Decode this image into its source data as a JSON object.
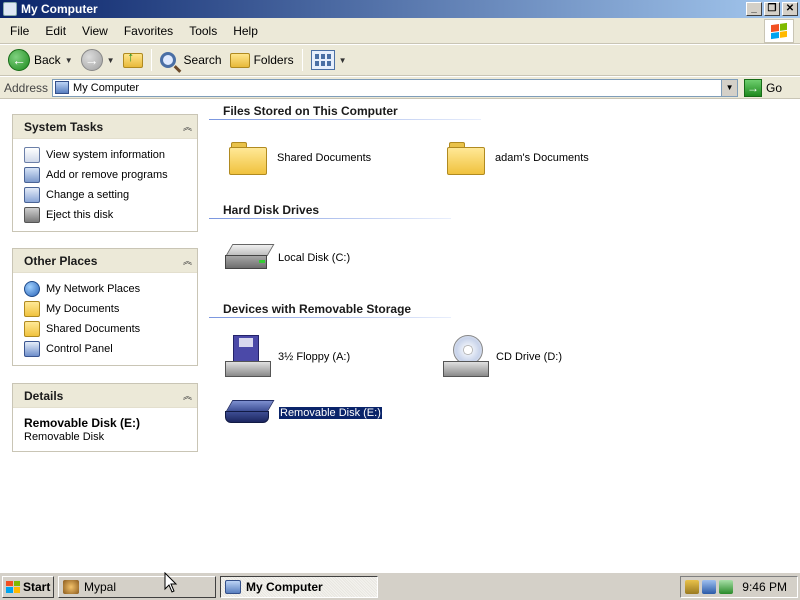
{
  "window": {
    "title": "My Computer"
  },
  "menu": [
    "File",
    "Edit",
    "View",
    "Favorites",
    "Tools",
    "Help"
  ],
  "toolbar": {
    "back": "Back",
    "search": "Search",
    "folders": "Folders"
  },
  "address": {
    "label": "Address",
    "value": "My Computer",
    "go": "Go"
  },
  "system_tasks": {
    "title": "System Tasks",
    "items": [
      "View system information",
      "Add or remove programs",
      "Change a setting",
      "Eject this disk"
    ]
  },
  "other_places": {
    "title": "Other Places",
    "items": [
      "My Network Places",
      "My Documents",
      "Shared Documents",
      "Control Panel"
    ]
  },
  "details": {
    "title": "Details",
    "name": "Removable Disk (E:)",
    "type": "Removable Disk"
  },
  "groups": {
    "files": {
      "title": "Files Stored on This Computer",
      "items": [
        "Shared Documents",
        "adam's Documents"
      ]
    },
    "hdd": {
      "title": "Hard Disk Drives",
      "items": [
        "Local Disk (C:)"
      ]
    },
    "removable": {
      "title": "Devices with Removable Storage",
      "items": [
        "3½ Floppy (A:)",
        "CD Drive (D:)",
        "Removable Disk (E:)"
      ]
    }
  },
  "taskbar": {
    "start": "Start",
    "tasks": [
      "Mypal",
      "My Computer"
    ],
    "clock": "9:46 PM"
  },
  "colors": {
    "selection": "#0a246a",
    "title_start": "#0a246a",
    "title_end": "#a6caf0",
    "panel_head": "#ece9d8"
  },
  "icons": [
    "windows-flag-icon",
    "back-icon",
    "forward-icon",
    "up-folder-icon",
    "search-icon",
    "folders-icon",
    "views-icon",
    "my-computer-icon",
    "go-icon",
    "system-info-icon",
    "add-remove-icon",
    "settings-icon",
    "eject-icon",
    "network-icon",
    "documents-icon",
    "shared-folder-icon",
    "control-panel-icon",
    "folder-icon",
    "hard-disk-icon",
    "floppy-icon",
    "cd-drive-icon",
    "removable-disk-icon"
  ]
}
